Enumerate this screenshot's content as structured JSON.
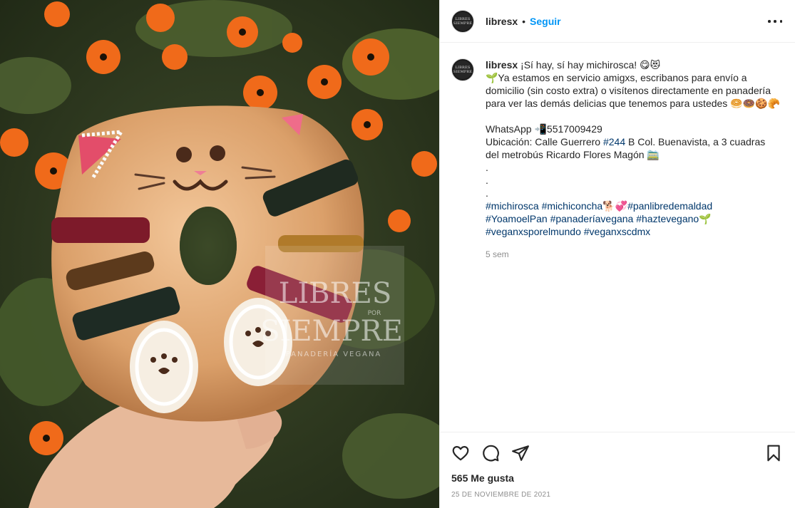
{
  "post": {
    "username": "libresx",
    "follow_label": "Seguir",
    "separator": "•",
    "avatar_lines": [
      "LIBRES",
      "SIEMPRE"
    ],
    "caption": {
      "line1": "¡Sí hay, sí hay michirosca! 😋😻",
      "line2": "🌱Ya estamos en servicio amigxs, escribanos para envío a",
      "line3": "domicilio (sin costo extra) o visítenos directamente en panadería",
      "line4": "para ver las demás delicias que tenemos para ustedes 🥯🍩🍪🥐",
      "whatsapp": "WhatsApp 📲5517009429",
      "ubic_prefix": "Ubicación: Calle Guerrero ",
      "ubic_tag": "#244",
      "ubic_suffix": " B Col. Buenavista, a 3 cuadras",
      "ubic_line2": "del metrobús Ricardo Flores Magón 🚞",
      "dot": ".",
      "hashtags_line1": [
        "#michirosca",
        "#michiconcha",
        "🐕💞",
        "#panlibredemaldad"
      ],
      "hashtags_line2": [
        "#YoamoelPan",
        "#panaderíavegana",
        "#haztevegano",
        "🌱"
      ],
      "hashtags_line3": [
        "#veganxsporelmundo",
        "#veganxscdmx"
      ]
    },
    "time_ago": "5 sem",
    "likes": "565 Me gusta",
    "date": "25 DE NOVIEMBRE DE 2021"
  },
  "image": {
    "watermark_line1": "LIBRES",
    "watermark_por": "POR",
    "watermark_line2": "SIEMPRE",
    "watermark_line3": "PANADERÍA VEGANA"
  },
  "icons": {
    "like": "heart-icon",
    "comment": "comment-icon",
    "share": "paper-plane-icon",
    "save": "bookmark-icon",
    "more": "more-options-icon"
  },
  "colors": {
    "link": "#0095f6",
    "hashtag": "#00376b",
    "muted": "#8e8e8e"
  }
}
